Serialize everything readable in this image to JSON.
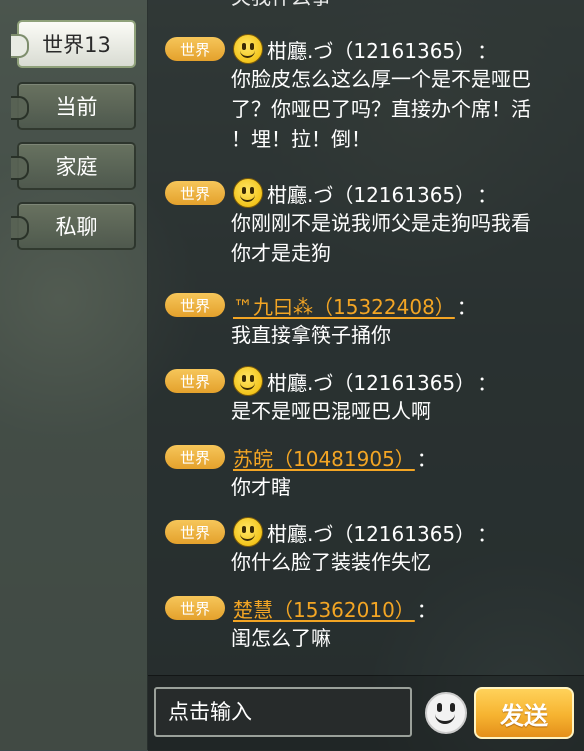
{
  "sidebar": {
    "tabs": [
      {
        "label": "世界13",
        "active": true
      },
      {
        "label": "当前",
        "active": false
      },
      {
        "label": "家庭",
        "active": false
      },
      {
        "label": "私聊",
        "active": false
      }
    ]
  },
  "chat": {
    "top_partial_text": "关我什么事",
    "messages": [
      {
        "channel": "世界",
        "avatar": "smiley-icon",
        "name": "柑廳.づ（12161365）",
        "name_style": "plain",
        "lines": [
          "你脸皮怎么这么厚一个是不是哑巴",
          "了？你哑巴了吗？直接办个席！活",
          "！埋！拉！倒！"
        ]
      },
      {
        "channel": "世界",
        "avatar": "smiley-icon",
        "name": "柑廳.づ（12161365）",
        "name_style": "plain",
        "lines": [
          "你刚刚不是说我师父是走狗吗我看",
          "你才是走狗"
        ]
      },
      {
        "channel": "世界",
        "avatar": null,
        "name": "™九曰⁂（15322408）",
        "name_style": "link",
        "lines": [
          "我直接拿筷子捅你"
        ]
      },
      {
        "channel": "世界",
        "avatar": "smiley-icon",
        "name": "柑廳.づ（12161365）",
        "name_style": "plain",
        "lines": [
          "是不是哑巴混哑巴人啊"
        ]
      },
      {
        "channel": "世界",
        "avatar": null,
        "name": "苏皖（10481905）",
        "name_style": "link",
        "lines": [
          "你才瞎"
        ]
      },
      {
        "channel": "世界",
        "avatar": "smiley-icon",
        "name": "柑廳.づ（12161365）",
        "name_style": "plain",
        "lines": [
          "你什么脸了装装作失忆"
        ]
      },
      {
        "channel": "世界",
        "avatar": null,
        "name": "楚慧（15362010）",
        "name_style": "link",
        "lines": [
          "闺怎么了嘛"
        ]
      }
    ],
    "colon": "："
  },
  "composer": {
    "placeholder": "点击输入",
    "send_label": "发送",
    "emoji_icon": "smiley-face-icon"
  },
  "colors": {
    "badge": "#f0b441",
    "link_name": "#f3a524",
    "send_button": "#f6b330"
  }
}
